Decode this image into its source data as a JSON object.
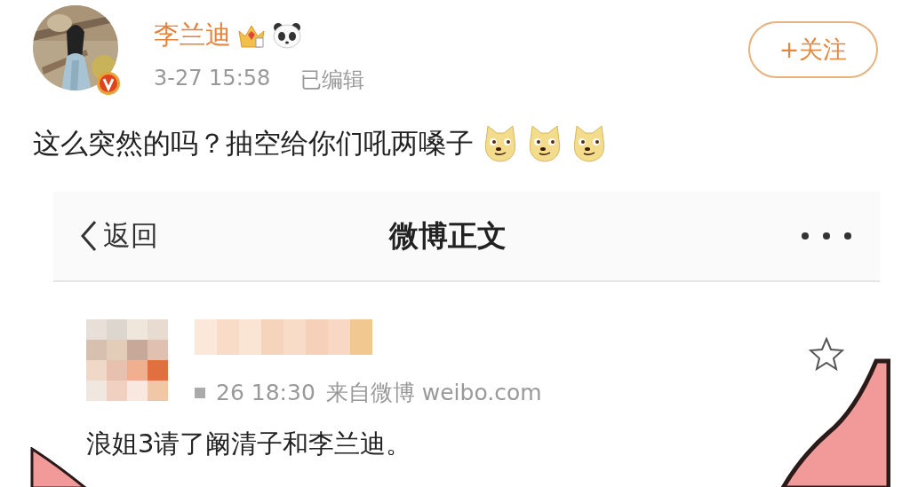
{
  "post": {
    "author": "李兰迪",
    "time": "3-27 15:58",
    "edited": "已编辑",
    "follow_button": "+关注",
    "text": "这么突然的吗？抽空给你们吼两嗓子",
    "emojis": [
      {
        "kind": "doge"
      },
      {
        "kind": "doge"
      },
      {
        "kind": "doge"
      }
    ]
  },
  "embedded_screenshot": {
    "back_button": "返回",
    "title": "微博正文",
    "post": {
      "meta": "26 18:30",
      "source": "来自微博 weibo.com",
      "text": "浪姐3请了阚清子和李兰迪。"
    }
  }
}
